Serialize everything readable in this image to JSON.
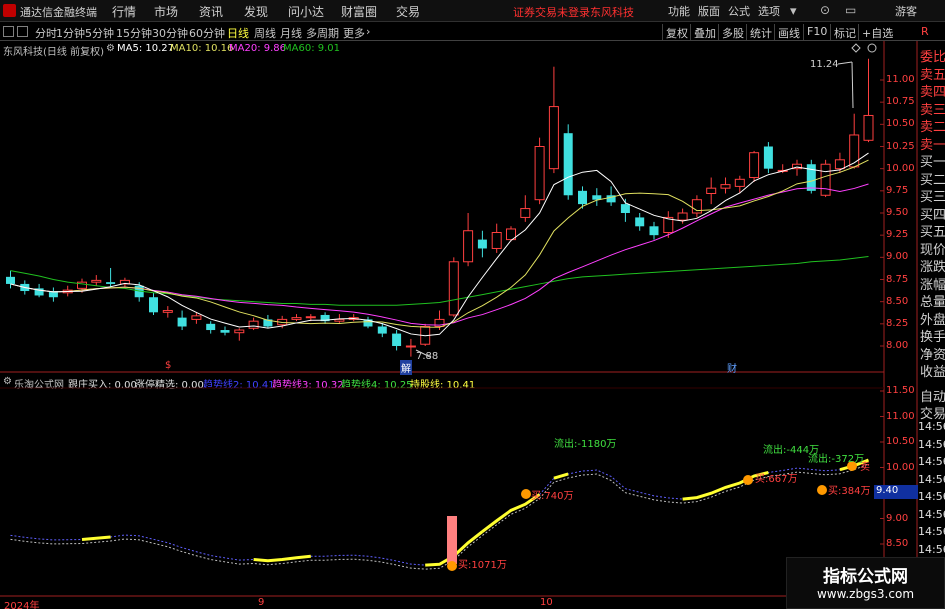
{
  "titlebar": {
    "app_name": "通达信金融终端",
    "menus": [
      "行情",
      "市场",
      "资讯",
      "发现",
      "问小达",
      "财富圈",
      "交易"
    ],
    "warning": "证券交易未登录",
    "stock": "东风科技",
    "right_menus": [
      "功能",
      "版面",
      "公式",
      "选项"
    ],
    "guest": "游客"
  },
  "periodbar": {
    "periods": [
      "分时",
      "1分钟",
      "5分钟",
      "15分钟",
      "30分钟",
      "60分钟",
      "日线",
      "周线",
      "月线",
      "多周期",
      "更多"
    ],
    "selected": "日线",
    "tools": [
      "复权",
      "叠加",
      "多股",
      "统计",
      "画线",
      "F10",
      "标记",
      "+自选"
    ],
    "r_label": "R"
  },
  "main_header": {
    "title": "东风科技(日线 前复权)",
    "ma5": "MA5: 10.27",
    "ma10": "MA10: 10.16",
    "ma20": "MA20: 9.86",
    "ma60": "MA60: 9.01"
  },
  "sub_header": {
    "title": "乐淘公式网",
    "i1": "跟庄买入: 0.00",
    "i2": "涨停精选: 0.00",
    "i3": "趋势线2: 10.41",
    "i4": "趋势线3: 10.32",
    "i5": "趋势线4: 10.25",
    "i6": "持股线: 10.41"
  },
  "right_side": [
    "委比",
    "卖五",
    "卖四",
    "卖三",
    "卖二",
    "卖一",
    "买一",
    "买二",
    "买三",
    "买四",
    "买五",
    "现价",
    "涨跌",
    "涨幅",
    "总量",
    "外盘",
    "换手",
    "净资",
    "收益"
  ],
  "right_side2": [
    "自动",
    "交易"
  ],
  "times": [
    "14:56",
    "14:56",
    "14:56",
    "14:56",
    "14:56",
    "14:56",
    "14:56",
    "14:56",
    "14:56"
  ],
  "price_axis": [
    "11.00",
    "10.75",
    "10.50",
    "10.25",
    "10.00",
    "9.75",
    "9.50",
    "9.25",
    "9.00",
    "8.75",
    "8.50",
    "8.25",
    "8.00"
  ],
  "sub_axis": [
    "11.50",
    "11.00",
    "10.50",
    "10.00",
    "9.50",
    "9.00",
    "8.50"
  ],
  "sub_current": "9.40",
  "annotations": {
    "high": "11.24",
    "low": "7.88",
    "buy1": "买:1071万",
    "buy2": "买:740万",
    "buy3": "买:667万",
    "buy4": "买:384万",
    "out1": "流出:-1180万",
    "out2": "流出:-444万",
    "out3": "流出:-372万",
    "sell": "卖"
  },
  "date_axis": [
    "2024年",
    "9",
    "10"
  ],
  "markers": {
    "s": "$",
    "jie": "解",
    "cai": "财"
  },
  "watermark": {
    "line1": "指标公式网",
    "line2": "www.zbgs3.com"
  },
  "colors": {
    "up": "#ff4040",
    "down": "#40e0e0",
    "ma5": "#ffffff",
    "ma10": "#e0e060",
    "ma20": "#ff40ff",
    "ma60": "#20c020"
  },
  "candles": [
    [
      8.78,
      8.7,
      8.85,
      8.65
    ],
    [
      8.7,
      8.62,
      8.74,
      8.58
    ],
    [
      8.65,
      8.57,
      8.7,
      8.55
    ],
    [
      8.62,
      8.55,
      8.66,
      8.5
    ],
    [
      8.6,
      8.63,
      8.68,
      8.56
    ],
    [
      8.65,
      8.72,
      8.76,
      8.6
    ],
    [
      8.72,
      8.74,
      8.8,
      8.68
    ],
    [
      8.72,
      8.7,
      8.88,
      8.66
    ],
    [
      8.7,
      8.74,
      8.77,
      8.67
    ],
    [
      8.68,
      8.55,
      8.72,
      8.5
    ],
    [
      8.55,
      8.38,
      8.6,
      8.35
    ],
    [
      8.38,
      8.4,
      8.45,
      8.32
    ],
    [
      8.32,
      8.22,
      8.4,
      8.18
    ],
    [
      8.3,
      8.34,
      8.38,
      8.25
    ],
    [
      8.25,
      8.18,
      8.28,
      8.14
    ],
    [
      8.18,
      8.15,
      8.22,
      8.12
    ],
    [
      8.15,
      8.18,
      8.2,
      8.06
    ],
    [
      8.2,
      8.28,
      8.32,
      8.18
    ],
    [
      8.3,
      8.22,
      8.35,
      8.2
    ],
    [
      8.24,
      8.3,
      8.34,
      8.2
    ],
    [
      8.3,
      8.32,
      8.36,
      8.28
    ],
    [
      8.33,
      8.33,
      8.36,
      8.28
    ],
    [
      8.35,
      8.28,
      8.38,
      8.25
    ],
    [
      8.28,
      8.3,
      8.36,
      8.26
    ],
    [
      8.3,
      8.32,
      8.36,
      8.28
    ],
    [
      8.3,
      8.22,
      8.33,
      8.2
    ],
    [
      8.22,
      8.14,
      8.26,
      8.1
    ],
    [
      8.14,
      8.0,
      8.18,
      7.95
    ],
    [
      8.0,
      8.0,
      8.08,
      7.88
    ],
    [
      8.02,
      8.22,
      8.25,
      8.0
    ],
    [
      8.22,
      8.3,
      8.4,
      8.18
    ],
    [
      8.35,
      8.95,
      9.0,
      8.33
    ],
    [
      8.95,
      9.3,
      9.5,
      8.9
    ],
    [
      9.2,
      9.1,
      9.3,
      9.0
    ],
    [
      9.1,
      9.28,
      9.38,
      9.05
    ],
    [
      9.2,
      9.32,
      9.35,
      9.18
    ],
    [
      9.45,
      9.55,
      9.7,
      9.4
    ],
    [
      9.65,
      10.25,
      10.35,
      9.6
    ],
    [
      10.0,
      10.7,
      11.15,
      9.95
    ],
    [
      10.4,
      9.7,
      10.5,
      9.65
    ],
    [
      9.75,
      9.6,
      9.8,
      9.55
    ],
    [
      9.7,
      9.65,
      9.78,
      9.58
    ],
    [
      9.7,
      9.62,
      9.8,
      9.58
    ],
    [
      9.6,
      9.5,
      9.66,
      9.4
    ],
    [
      9.45,
      9.35,
      9.5,
      9.3
    ],
    [
      9.35,
      9.25,
      9.4,
      9.2
    ],
    [
      9.28,
      9.45,
      9.52,
      9.22
    ],
    [
      9.42,
      9.5,
      9.55,
      9.38
    ],
    [
      9.5,
      9.65,
      9.7,
      9.45
    ],
    [
      9.72,
      9.78,
      9.9,
      9.6
    ],
    [
      9.78,
      9.82,
      9.9,
      9.72
    ],
    [
      9.8,
      9.88,
      9.92,
      9.72
    ],
    [
      9.9,
      10.18,
      10.2,
      9.85
    ],
    [
      10.25,
      10.0,
      10.3,
      9.95
    ],
    [
      9.98,
      9.98,
      10.05,
      9.95
    ],
    [
      10.0,
      10.05,
      10.1,
      9.92
    ],
    [
      10.05,
      9.75,
      10.1,
      9.72
    ],
    [
      9.7,
      10.05,
      10.1,
      9.68
    ],
    [
      10.0,
      10.1,
      10.18,
      9.95
    ],
    [
      10.02,
      10.38,
      10.62,
      10.0
    ],
    [
      10.32,
      10.6,
      11.24,
      10.3
    ]
  ],
  "ma60_line": [
    8.85,
    8.82,
    8.79,
    8.75,
    8.72,
    8.7,
    8.68,
    8.66,
    8.65,
    8.62,
    8.6,
    8.59,
    8.57,
    8.55,
    8.53,
    8.52,
    8.51,
    8.5,
    8.49,
    8.48,
    8.48,
    8.47,
    8.47,
    8.46,
    8.46,
    8.46,
    8.46,
    8.46,
    8.47,
    8.48,
    8.49,
    8.52,
    8.55,
    8.58,
    8.61,
    8.64,
    8.67,
    8.7,
    8.73,
    8.76,
    8.78,
    8.79,
    8.8,
    8.81,
    8.82,
    8.83,
    8.84,
    8.85,
    8.86,
    8.87,
    8.88,
    8.89,
    8.9,
    8.91,
    8.92,
    8.93,
    8.95,
    8.96,
    8.97,
    8.99,
    9.01
  ]
}
